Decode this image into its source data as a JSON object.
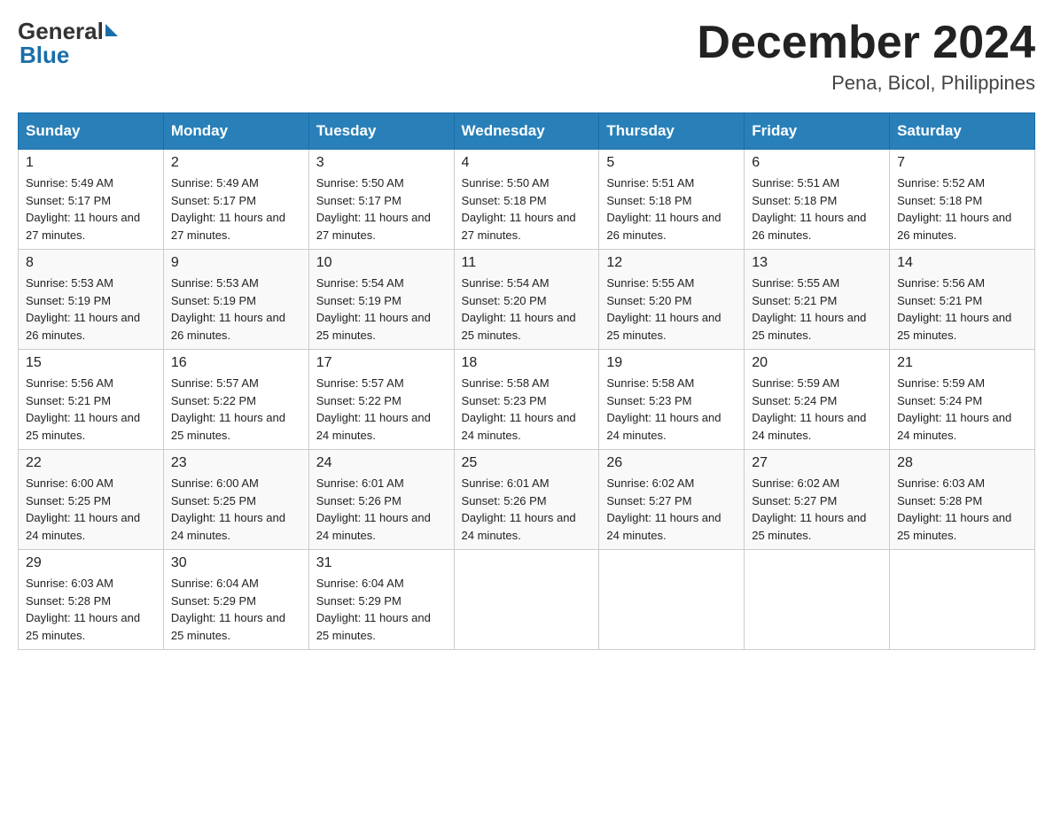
{
  "header": {
    "logo_text": "General",
    "logo_blue": "Blue",
    "month_title": "December 2024",
    "location": "Pena, Bicol, Philippines"
  },
  "days_of_week": [
    "Sunday",
    "Monday",
    "Tuesday",
    "Wednesday",
    "Thursday",
    "Friday",
    "Saturday"
  ],
  "weeks": [
    [
      {
        "day": "1",
        "sunrise": "5:49 AM",
        "sunset": "5:17 PM",
        "daylight": "11 hours and 27 minutes."
      },
      {
        "day": "2",
        "sunrise": "5:49 AM",
        "sunset": "5:17 PM",
        "daylight": "11 hours and 27 minutes."
      },
      {
        "day": "3",
        "sunrise": "5:50 AM",
        "sunset": "5:17 PM",
        "daylight": "11 hours and 27 minutes."
      },
      {
        "day": "4",
        "sunrise": "5:50 AM",
        "sunset": "5:18 PM",
        "daylight": "11 hours and 27 minutes."
      },
      {
        "day": "5",
        "sunrise": "5:51 AM",
        "sunset": "5:18 PM",
        "daylight": "11 hours and 26 minutes."
      },
      {
        "day": "6",
        "sunrise": "5:51 AM",
        "sunset": "5:18 PM",
        "daylight": "11 hours and 26 minutes."
      },
      {
        "day": "7",
        "sunrise": "5:52 AM",
        "sunset": "5:18 PM",
        "daylight": "11 hours and 26 minutes."
      }
    ],
    [
      {
        "day": "8",
        "sunrise": "5:53 AM",
        "sunset": "5:19 PM",
        "daylight": "11 hours and 26 minutes."
      },
      {
        "day": "9",
        "sunrise": "5:53 AM",
        "sunset": "5:19 PM",
        "daylight": "11 hours and 26 minutes."
      },
      {
        "day": "10",
        "sunrise": "5:54 AM",
        "sunset": "5:19 PM",
        "daylight": "11 hours and 25 minutes."
      },
      {
        "day": "11",
        "sunrise": "5:54 AM",
        "sunset": "5:20 PM",
        "daylight": "11 hours and 25 minutes."
      },
      {
        "day": "12",
        "sunrise": "5:55 AM",
        "sunset": "5:20 PM",
        "daylight": "11 hours and 25 minutes."
      },
      {
        "day": "13",
        "sunrise": "5:55 AM",
        "sunset": "5:21 PM",
        "daylight": "11 hours and 25 minutes."
      },
      {
        "day": "14",
        "sunrise": "5:56 AM",
        "sunset": "5:21 PM",
        "daylight": "11 hours and 25 minutes."
      }
    ],
    [
      {
        "day": "15",
        "sunrise": "5:56 AM",
        "sunset": "5:21 PM",
        "daylight": "11 hours and 25 minutes."
      },
      {
        "day": "16",
        "sunrise": "5:57 AM",
        "sunset": "5:22 PM",
        "daylight": "11 hours and 25 minutes."
      },
      {
        "day": "17",
        "sunrise": "5:57 AM",
        "sunset": "5:22 PM",
        "daylight": "11 hours and 24 minutes."
      },
      {
        "day": "18",
        "sunrise": "5:58 AM",
        "sunset": "5:23 PM",
        "daylight": "11 hours and 24 minutes."
      },
      {
        "day": "19",
        "sunrise": "5:58 AM",
        "sunset": "5:23 PM",
        "daylight": "11 hours and 24 minutes."
      },
      {
        "day": "20",
        "sunrise": "5:59 AM",
        "sunset": "5:24 PM",
        "daylight": "11 hours and 24 minutes."
      },
      {
        "day": "21",
        "sunrise": "5:59 AM",
        "sunset": "5:24 PM",
        "daylight": "11 hours and 24 minutes."
      }
    ],
    [
      {
        "day": "22",
        "sunrise": "6:00 AM",
        "sunset": "5:25 PM",
        "daylight": "11 hours and 24 minutes."
      },
      {
        "day": "23",
        "sunrise": "6:00 AM",
        "sunset": "5:25 PM",
        "daylight": "11 hours and 24 minutes."
      },
      {
        "day": "24",
        "sunrise": "6:01 AM",
        "sunset": "5:26 PM",
        "daylight": "11 hours and 24 minutes."
      },
      {
        "day": "25",
        "sunrise": "6:01 AM",
        "sunset": "5:26 PM",
        "daylight": "11 hours and 24 minutes."
      },
      {
        "day": "26",
        "sunrise": "6:02 AM",
        "sunset": "5:27 PM",
        "daylight": "11 hours and 24 minutes."
      },
      {
        "day": "27",
        "sunrise": "6:02 AM",
        "sunset": "5:27 PM",
        "daylight": "11 hours and 25 minutes."
      },
      {
        "day": "28",
        "sunrise": "6:03 AM",
        "sunset": "5:28 PM",
        "daylight": "11 hours and 25 minutes."
      }
    ],
    [
      {
        "day": "29",
        "sunrise": "6:03 AM",
        "sunset": "5:28 PM",
        "daylight": "11 hours and 25 minutes."
      },
      {
        "day": "30",
        "sunrise": "6:04 AM",
        "sunset": "5:29 PM",
        "daylight": "11 hours and 25 minutes."
      },
      {
        "day": "31",
        "sunrise": "6:04 AM",
        "sunset": "5:29 PM",
        "daylight": "11 hours and 25 minutes."
      },
      null,
      null,
      null,
      null
    ]
  ]
}
